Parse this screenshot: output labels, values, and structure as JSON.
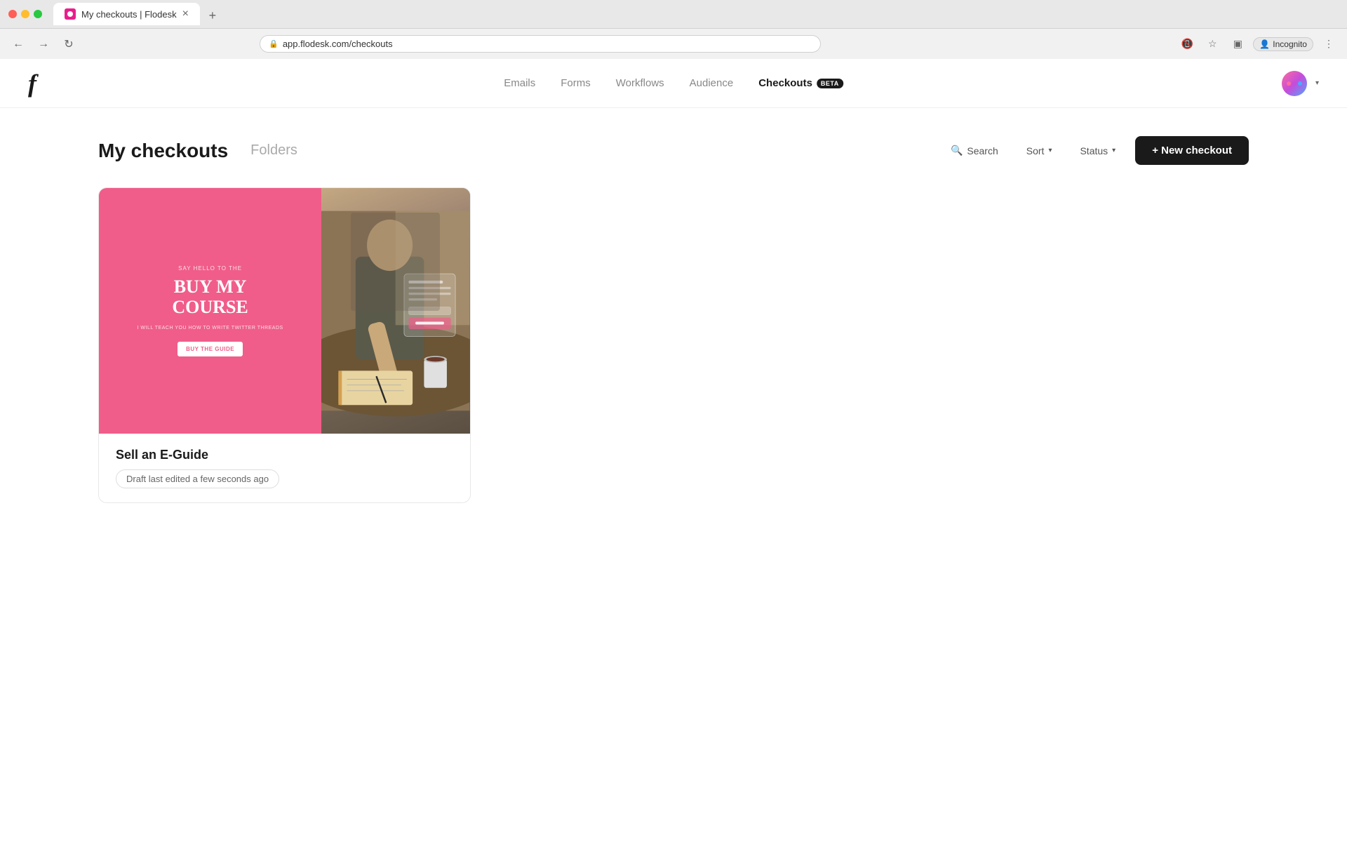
{
  "browser": {
    "tab_title": "My checkouts | Flodesk",
    "tab_close": "×",
    "new_tab": "+",
    "address": "app.flodesk.com/checkouts",
    "back_icon": "←",
    "forward_icon": "→",
    "refresh_icon": "↻",
    "profile_label": "Incognito",
    "nav_overflow": "⋮"
  },
  "app": {
    "logo": "f"
  },
  "nav": {
    "links": [
      {
        "label": "Emails",
        "active": false
      },
      {
        "label": "Forms",
        "active": false
      },
      {
        "label": "Workflows",
        "active": false
      },
      {
        "label": "Audience",
        "active": false
      },
      {
        "label": "Checkouts",
        "active": true,
        "badge": "BETA"
      }
    ]
  },
  "page": {
    "title": "My checkouts",
    "tabs": [
      {
        "label": "Folders",
        "active": false
      }
    ]
  },
  "actions": {
    "search_label": "Search",
    "sort_label": "Sort",
    "sort_chevron": "▾",
    "status_label": "Status",
    "status_chevron": "▾",
    "new_checkout_label": "+ New checkout"
  },
  "checkouts": [
    {
      "id": "1",
      "name": "Sell an E-Guide",
      "status": "Draft last edited a few seconds ago",
      "preview": {
        "say_hello": "SAY HELLO TO THE",
        "title_line1": "BUY MY",
        "title_line2": "COURSE",
        "subtitle": "I WILL TEACH YOU HOW TO WRITE TWITTER THREADS",
        "cta": "BUY THE GUIDE"
      }
    }
  ]
}
